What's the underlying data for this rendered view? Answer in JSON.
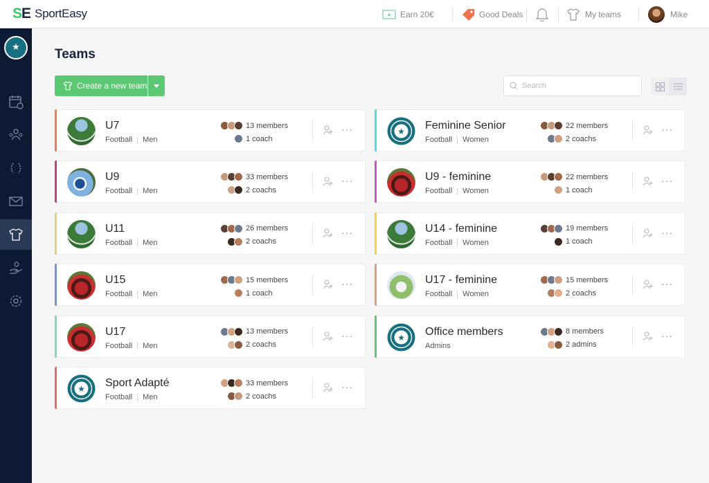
{
  "app": {
    "logo_mark_s": "S",
    "logo_mark_e": "E",
    "name": "SportEasy"
  },
  "topbar": {
    "earn": "Earn 20€",
    "deals": "Good Deals",
    "my_teams": "My teams",
    "user": "Mike"
  },
  "colors": {
    "accent": "#5cc874",
    "sidebar": "#0d1a33"
  },
  "page": {
    "title": "Teams",
    "create_button": "Create a new team",
    "search_placeholder": "Search"
  },
  "teams_left": [
    {
      "name": "U7",
      "sport": "Football",
      "category": "Men",
      "members": "13 members",
      "staff": "1 coach",
      "color": "#f07a4f",
      "photo": "grass"
    },
    {
      "name": "U9",
      "sport": "Football",
      "category": "Men",
      "members": "33 members",
      "staff": "2 coachs",
      "color": "#c0417f",
      "photo": "sky"
    },
    {
      "name": "U11",
      "sport": "Football",
      "category": "Men",
      "members": "26 members",
      "staff": "2 coachs",
      "color": "#e6cf78",
      "photo": "grass"
    },
    {
      "name": "U15",
      "sport": "Football",
      "category": "Men",
      "members": "15 members",
      "staff": "1 coach",
      "color": "#6f97d6",
      "photo": "red"
    },
    {
      "name": "U17",
      "sport": "Football",
      "category": "Men",
      "members": "13 members",
      "staff": "2 coachs",
      "color": "#7fd9b6",
      "photo": "red"
    },
    {
      "name": "Sport Adapté",
      "sport": "Football",
      "category": "Men",
      "members": "33 members",
      "staff": "2 coachs",
      "color": "#e26c6c",
      "photo": "logo"
    }
  ],
  "teams_right": [
    {
      "name": "Feminine Senior",
      "sport": "Football",
      "category": "Women",
      "members": "22 members",
      "staff": "2 coachs",
      "color": "#4fdbe0",
      "photo": "logo"
    },
    {
      "name": "U9 - feminine",
      "sport": "Football",
      "category": "Women",
      "members": "22 members",
      "staff": "1 coach",
      "color": "#d052c8",
      "photo": "red"
    },
    {
      "name": "U14 - feminine",
      "sport": "Football",
      "category": "Women",
      "members": "19 members",
      "staff": "1 coach",
      "color": "#f5d13a",
      "photo": "grass"
    },
    {
      "name": "U17 - feminine",
      "sport": "Football",
      "category": "Women",
      "members": "15 members",
      "staff": "2 coachs",
      "color": "#d9a27e",
      "photo": "field"
    },
    {
      "name": "Office members",
      "sport": "Admins",
      "category": "",
      "members": "8 members",
      "staff": "2 admins",
      "color": "#5cc874",
      "photo": "logo"
    }
  ]
}
